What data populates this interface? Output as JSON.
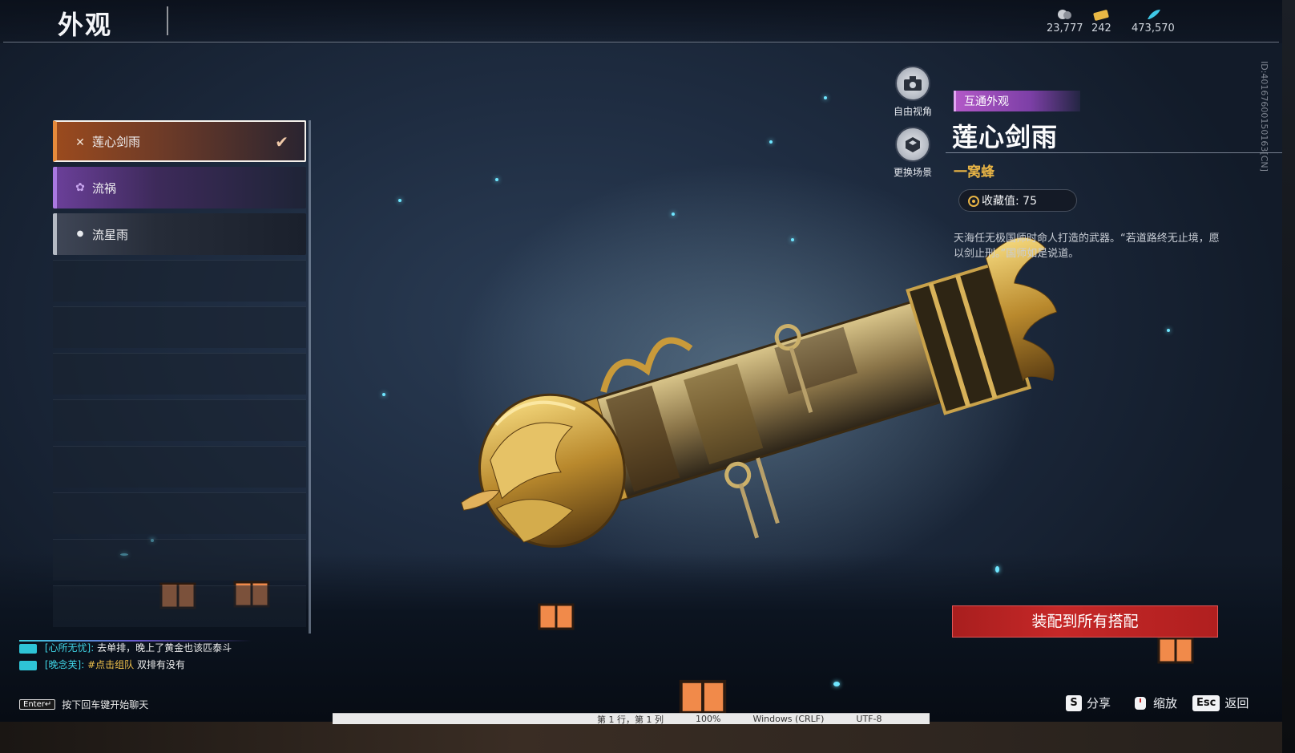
{
  "header": {
    "title": "外观",
    "currencies": [
      {
        "icon": "coin-icon",
        "value": "23,777"
      },
      {
        "icon": "ticket-icon",
        "value": "242"
      },
      {
        "icon": "feather-icon",
        "value": "473,570"
      }
    ]
  },
  "list": {
    "items": [
      {
        "label": "莲心剑雨",
        "icon": "lotus-icon",
        "selected": true,
        "rarity_color": "#e58a3b"
      },
      {
        "label": "流祸",
        "icon": "blossom-icon",
        "selected": false,
        "rarity_color": "#a978e0"
      },
      {
        "label": "流星雨",
        "icon": "droplet-icon",
        "selected": false,
        "rarity_color": "#b4bac4"
      }
    ]
  },
  "view_buttons": {
    "free_view": "自由视角",
    "change_scene": "更换场景"
  },
  "detail": {
    "tag": "互通外观",
    "name": "莲心剑雨",
    "series": "一窝蜂",
    "collect_value": "收藏值: 75",
    "description": "天海任无极国师时命人打造的武器。“若道路终无止境，愿以剑止刑。”国师如是说道。",
    "equip_button": "装配到所有搭配",
    "uid": "ID:40167600150163[CN]"
  },
  "hints": {
    "share_key": "S",
    "share_label": "分享",
    "zoom_label": "缩放",
    "back_key": "Esc",
    "back_label": "返回"
  },
  "chat": {
    "messages": [
      {
        "name": "[心所无忧]:",
        "text": "去单排，晚上了黄金也该匹泰斗",
        "link": ""
      },
      {
        "name": "[晚念芙]:",
        "text": " 双排有没有",
        "link": "#点击组队"
      }
    ],
    "enter_key": "Enter↵",
    "hint": "按下回车键开始聊天"
  },
  "desktop_bar": {
    "cursor_pos": "第 1 行，第 1 列",
    "zoom": "100%",
    "line_ending": "Windows (CRLF)",
    "encoding": "UTF-8"
  },
  "colors": {
    "accent_orange": "#e58a3b",
    "accent_purple": "#a978e0",
    "equip_red": "#c62828",
    "series_gold": "#e8b445",
    "chat_cyan": "#3fd5e6"
  }
}
